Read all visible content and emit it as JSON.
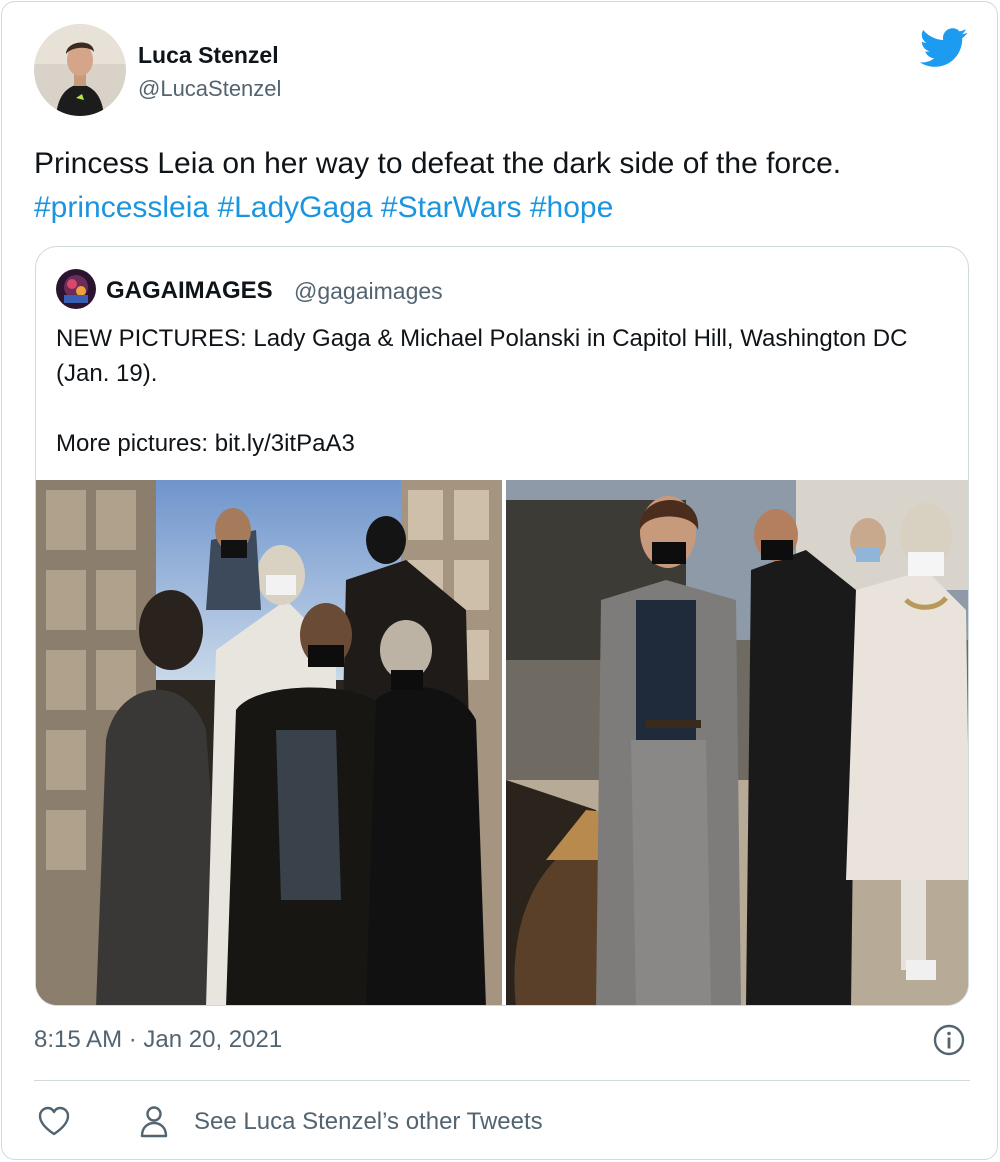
{
  "author": {
    "name": "Luca Stenzel",
    "handle": "@LucaStenzel"
  },
  "tweet": {
    "text": "Princess Leia on her way to defeat the dark side of the force.",
    "hashtags": [
      "#princessleia",
      "#LadyGaga",
      "#StarWars",
      "#hope"
    ]
  },
  "quoted_tweet": {
    "name": "GAGAIMAGES",
    "handle": "@gagaimages",
    "text_line1": "NEW PICTURES: Lady Gaga & Michael Polanski in Capitol Hill, Washington DC (Jan. 19).",
    "text_line2": "",
    "text_line3": "More pictures: bit.ly/3itPaA3"
  },
  "footer": {
    "timestamp": "8:15 AM · Jan 20, 2021",
    "other_tweets_label": "See Luca Stenzel’s other Tweets"
  },
  "icons": {
    "brand": "twitter-bird-icon",
    "info": "info-icon",
    "like": "heart-icon",
    "profile": "person-icon"
  },
  "colors": {
    "link": "#1b95e0",
    "brand": "#1d9bf0",
    "text": "#0f1419",
    "secondary": "#536471",
    "border": "#cfd9de"
  }
}
